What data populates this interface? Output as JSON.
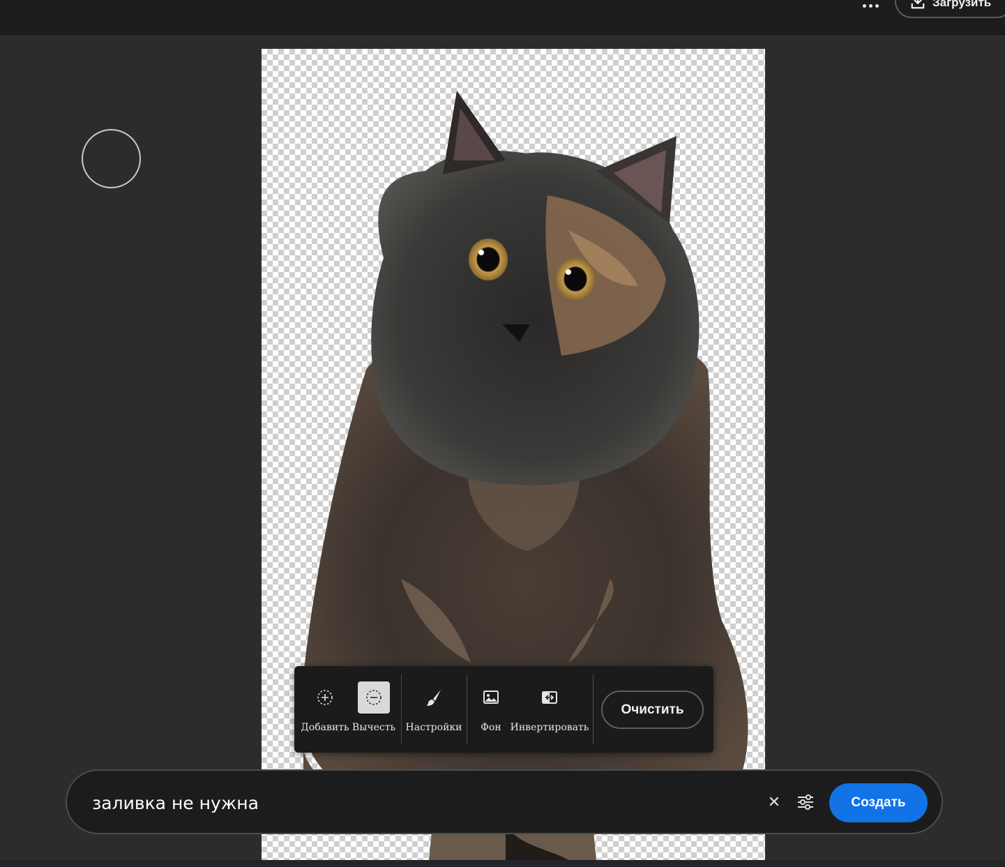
{
  "header": {
    "more_icon": "more-horizontal-icon",
    "download_label": "Загрузить",
    "download_icon": "download-icon"
  },
  "canvas": {
    "subject": "cat-cutout",
    "background": "transparency-checkerboard"
  },
  "toolbar": {
    "tools": [
      {
        "id": "add",
        "label": "Добавить",
        "icon": "add-selection-icon",
        "active": false
      },
      {
        "id": "subtract",
        "label": "Вычесть",
        "icon": "subtract-selection-icon",
        "active": true
      },
      {
        "id": "settings",
        "label": "Настройки",
        "icon": "brush-icon",
        "active": false
      },
      {
        "id": "background",
        "label": "Фон",
        "icon": "image-icon",
        "active": false
      },
      {
        "id": "invert",
        "label": "Инвертировать",
        "icon": "invert-icon",
        "active": false
      }
    ],
    "clear_label": "Очистить"
  },
  "prompt": {
    "value": "заливка не нужна",
    "clear_icon": "close-icon",
    "settings_icon": "sliders-icon",
    "create_label": "Создать"
  },
  "colors": {
    "accent": "#1273e6",
    "topbar": "#1c1c1c",
    "workspace": "#2c2c2c",
    "toolbar": "#1b1b1b"
  }
}
